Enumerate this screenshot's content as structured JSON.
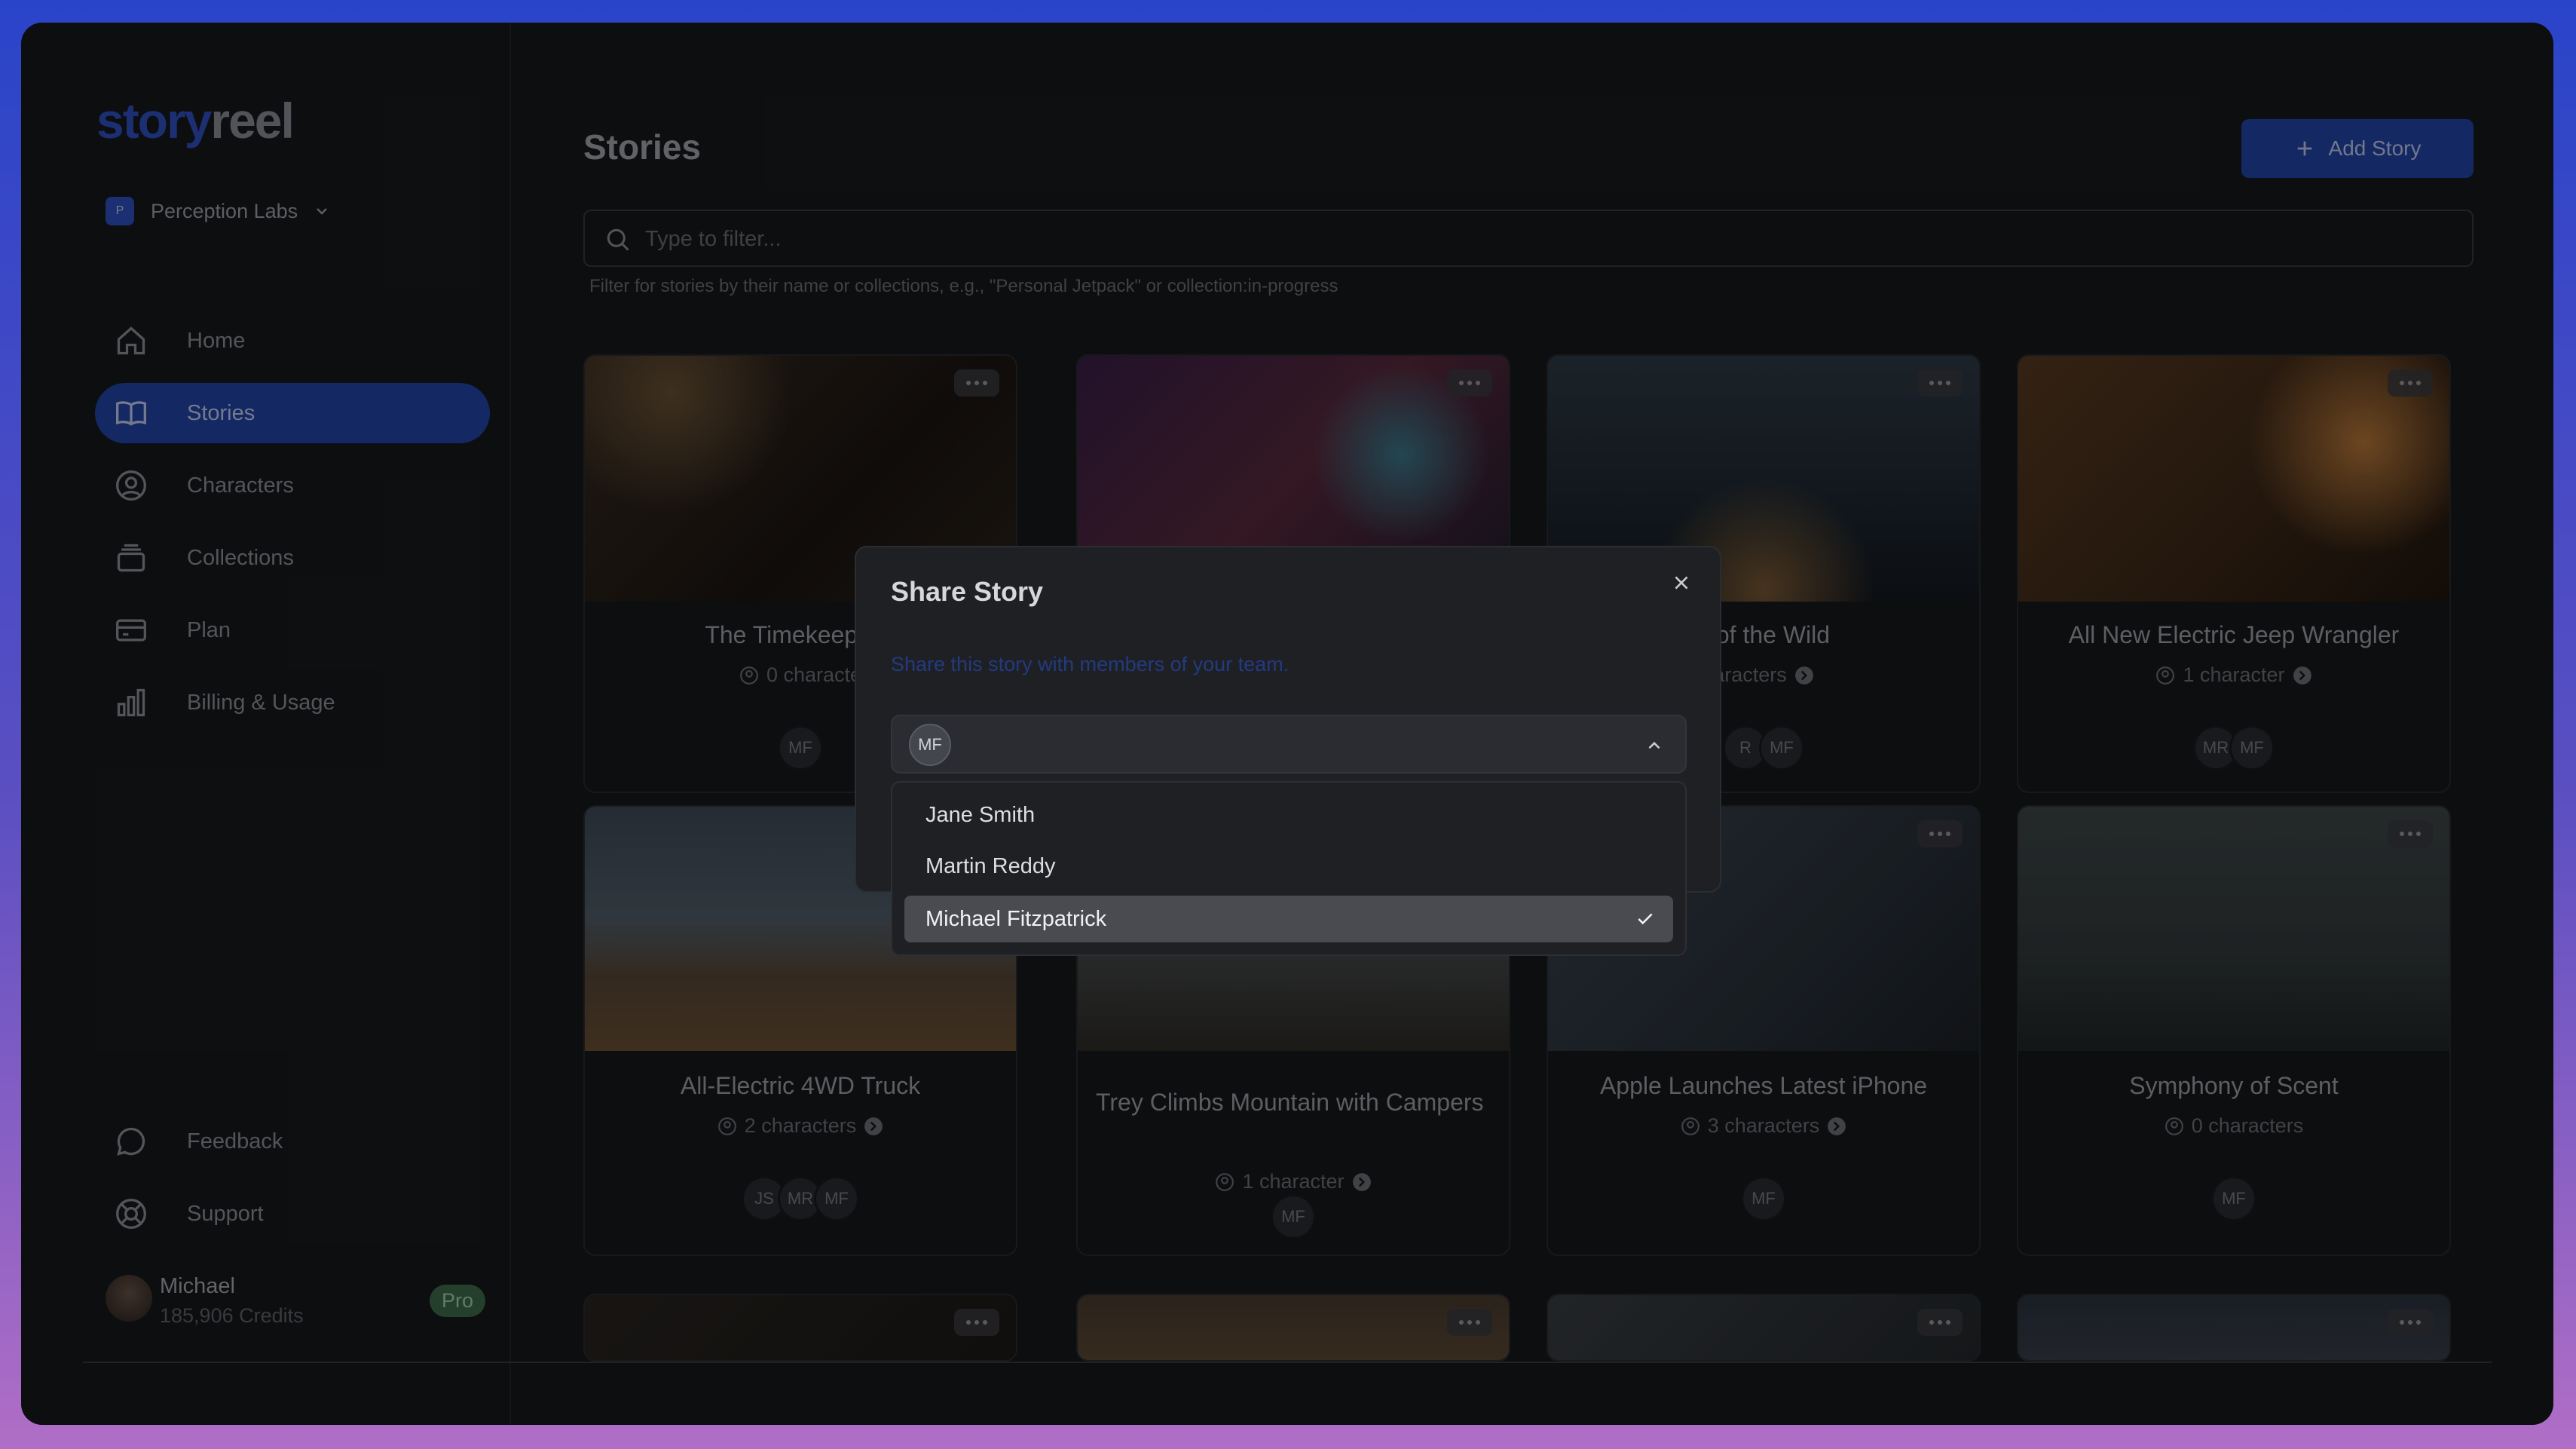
{
  "app": {
    "logo_part1": "story",
    "logo_part2": "reel",
    "org_badge": "P",
    "org_name": "Perception Labs"
  },
  "nav": [
    {
      "label": "Home",
      "icon": "home-icon"
    },
    {
      "label": "Stories",
      "icon": "book-icon",
      "active": true
    },
    {
      "label": "Characters",
      "icon": "user-circle-icon"
    },
    {
      "label": "Collections",
      "icon": "stack-icon"
    },
    {
      "label": "Plan",
      "icon": "credit-card-icon"
    },
    {
      "label": "Billing & Usage",
      "icon": "bar-chart-icon"
    }
  ],
  "nav_bottom": [
    {
      "label": "Feedback",
      "icon": "message-icon"
    },
    {
      "label": "Support",
      "icon": "lifebuoy-icon"
    }
  ],
  "user": {
    "name": "Michael",
    "credits": "185,906 Credits",
    "plan_badge": "Pro"
  },
  "main": {
    "title": "Stories",
    "add_button": "Add Story",
    "filter_placeholder": "Type to filter...",
    "filter_hint": "Filter for stories by their name or collections, e.g., \"Personal Jetpack\" or collection:in-progress"
  },
  "cards": [
    {
      "title": "The Timekeeper's",
      "characters": "0 characte",
      "avatars": [
        "MF"
      ]
    },
    {
      "title": "",
      "characters": "",
      "avatars": []
    },
    {
      "title": "s of the Wild",
      "characters": "aracters",
      "avatars": [
        "R",
        "MF"
      ]
    },
    {
      "title": "All New Electric Jeep Wrangler",
      "characters": "1 character",
      "avatars": [
        "MR",
        "MF"
      ]
    },
    {
      "title": "All-Electric 4WD Truck",
      "characters": "2 characters",
      "avatars": [
        "JS",
        "MR",
        "MF"
      ]
    },
    {
      "title": "Trey Climbs Mountain with Campers",
      "characters": "1 character",
      "avatars": [
        "MF"
      ]
    },
    {
      "title": "Apple Launches Latest iPhone",
      "characters": "3 characters",
      "avatars": [
        "MF"
      ]
    },
    {
      "title": "Symphony of Scent",
      "characters": "0 characters",
      "avatars": [
        "MF"
      ]
    }
  ],
  "modal": {
    "title": "Share Story",
    "description": "Share this story with members of your team.",
    "selected_chip": "MF",
    "options": [
      {
        "label": "Jane Smith",
        "selected": false
      },
      {
        "label": "Martin Reddy",
        "selected": false
      },
      {
        "label": "Michael Fitzpatrick",
        "selected": true
      }
    ]
  },
  "colors": {
    "accent": "#2446ad",
    "background": "#18191c",
    "pro_badge": "#3f6e4e"
  }
}
